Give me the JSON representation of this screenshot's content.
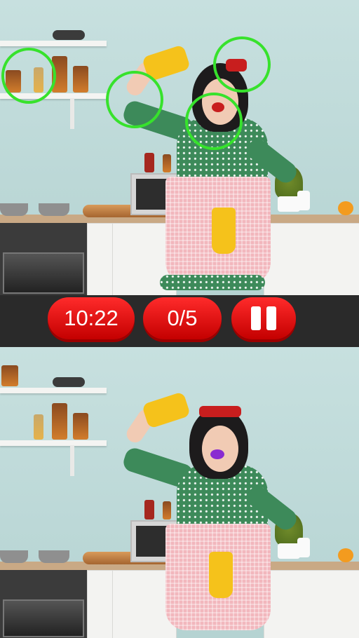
{
  "hud": {
    "timer": "10:22",
    "differences_found": "0/5"
  },
  "icons": {
    "pause": "pause-icon"
  },
  "colors": {
    "accent": "#e60000",
    "marker": "#37e22c"
  }
}
